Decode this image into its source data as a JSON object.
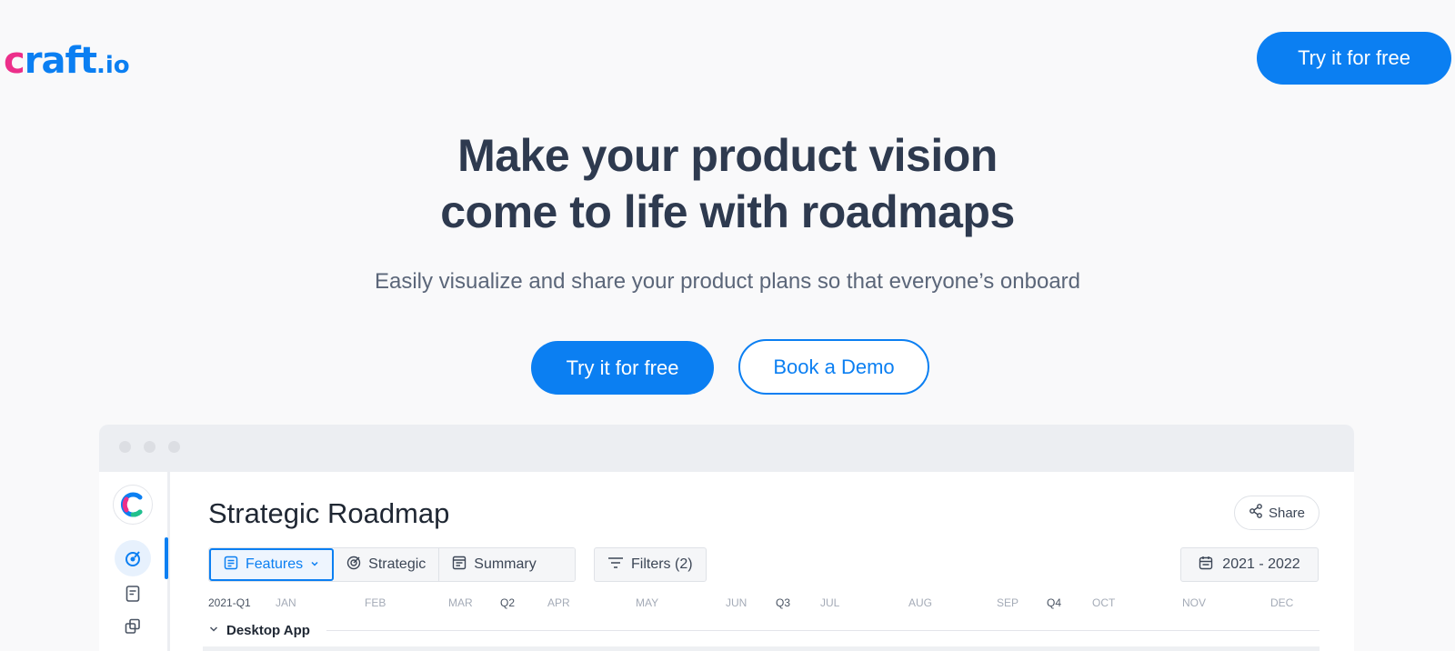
{
  "nav": {
    "logo_c": "c",
    "logo_text": "raft",
    "logo_dot": ".",
    "logo_io": "io",
    "cta": "Try it for free"
  },
  "hero": {
    "title_line1": "Make your product vision",
    "title_line2": "come to life with roadmaps",
    "subtitle": "Easily visualize and share your product plans so that everyone’s onboard",
    "primary_cta": "Try it for free",
    "secondary_cta": "Book a Demo"
  },
  "mockup": {
    "title": "Strategic Roadmap",
    "share_label": "Share",
    "tabs": [
      {
        "label": "Features",
        "icon": "document-icon"
      },
      {
        "label": "Strategic",
        "icon": "target-icon"
      },
      {
        "label": "Summary",
        "icon": "summary-icon"
      }
    ],
    "filters_label": "Filters (2)",
    "date_range": "2021 - 2022",
    "timeline": [
      "2021-Q1",
      "JAN",
      "FEB",
      "MAR",
      "Q2",
      "APR",
      "MAY",
      "JUN",
      "Q3",
      "JUL",
      "AUG",
      "SEP",
      "Q4",
      "OCT",
      "NOV",
      "DEC"
    ],
    "group_label": "Desktop App"
  },
  "colors": {
    "accent": "#0b7ff2",
    "logo_pink": "#ec2f8a",
    "heading": "#2e3a4f",
    "background": "#f9f9fa"
  }
}
